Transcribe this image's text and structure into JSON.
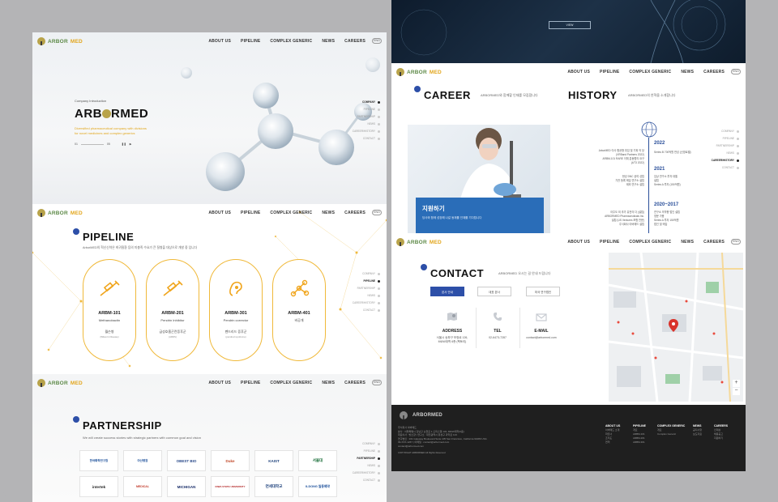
{
  "brand": {
    "part1": "ARBOR",
    "part2": "MED"
  },
  "nav": {
    "items": [
      "ABOUT US",
      "PIPELINE",
      "COMPLEX GENERIC",
      "NEWS",
      "CAREERS"
    ],
    "lang": "ENG"
  },
  "sidenav": {
    "items": [
      "COMPANY",
      "PIPELINE",
      "PARTNERSHIP",
      "NEWS",
      "CAREER/HISTORY",
      "CONTACT"
    ]
  },
  "hero": {
    "eyebrow": "Company Introduction",
    "title_a": "ARB",
    "title_b": "RMED",
    "desc1": "Diversified pharmaceutical company with divisions",
    "desc2": "for novel medicines and complex generics",
    "page_start": "01",
    "page_end": "05"
  },
  "pipeline": {
    "title": "PIPELINE",
    "subtitle": "ArborMED의 혁신신약은 희귀질환 등의 미충족 수요가 큰 질병을 대상으로 개발 중 입니다",
    "items": [
      {
        "code": "ARBM-101",
        "name": "Methanobactin",
        "ko": "월슨병",
        "en": "(Wilson's Disease)"
      },
      {
        "code": "ARBM-201",
        "name": "Pendrin Inhibitor",
        "ko": "급성호흡곤란증후군",
        "en": "(ARDS)"
      },
      {
        "code": "ARBM-301",
        "name": "Pendrin corrector",
        "ko": "펜드리드 증후군",
        "en": "(pendred syndrome)"
      },
      {
        "code": "ARBM-401",
        "name": "",
        "ko": "비공개",
        "en": ""
      }
    ]
  },
  "partnership": {
    "title": "PARTNERSHIP",
    "subtitle": "We will create success stories with strategic partners with common goal and vision",
    "row1": [
      "한국화학연구원",
      "아산병원",
      "OBEST BIO",
      "Duke",
      "KAIST",
      "서울대"
    ],
    "row2": [
      "intertek",
      "MEDICAL",
      "MICHIGAN",
      "IOWA STATE UNIVERSITY",
      "연세대학교",
      "ILDONG 일동제약"
    ]
  },
  "banner": {
    "button": "VIEW"
  },
  "career": {
    "title": "CAREER",
    "subtitle": "ARBORMED와 함께할 인재를 모집합니다",
    "card_title": "지원하기",
    "card_text": "당사와 함께 성장해 나갈 동재를 인재를 기다립니다"
  },
  "history": {
    "title": "HISTORY",
    "subtitle": "ARBORMED의 연혁을 소개합니다",
    "years": [
      "2022",
      "2021",
      "2020~2017"
    ],
    "y2022": [
      "ArborMED 이사 함공형 취임 및 기획 의 당",
      "(VRBand Partners 2022)",
      "ARBM-101 RARE 이체 분동협의 요구",
      "(4/73 2022)"
    ],
    "y2022r": [
      "Series B 700억원 천성 (신영로벨)"
    ],
    "y2021": [
      "현성 DNC 공여 성립",
      "기관 등록 매입 연구소 설립",
      "제외 연구소 설립",
      "임상 연구소 투자 대통",
      "설립",
      "Series A 투자 (150억원)"
    ],
    "y2020": [
      "아주도 외 추가 유전의 다 (설립)",
      "ARBORMED Pharmaceuticals Inc.",
      "설립 (US Ventures 포함 전문)",
      "주식회사 아버메드 설립"
    ],
    "y2020r": [
      "연구소 의약용 법인 설립",
      "영문 가용",
      "Series A 투자 150억원",
      "법인 및 매입"
    ]
  },
  "contact": {
    "title": "CONTACT",
    "subtitle": "ARBORMED 오시는 길 안내 드립니다",
    "buttons": [
      "본사 안내",
      "대표 본사",
      "미국 연구법인"
    ],
    "info": [
      {
        "label": "ADDRESS",
        "value": "서울시 송파구 보정로 126,",
        "value2": "M6/W대학 6층 (팩토리)"
      },
      {
        "label": "TEL",
        "value": "02-6473-7287",
        "value2": ""
      },
      {
        "label": "E-MAIL",
        "value": "contact@arbormed.com",
        "value2": ""
      }
    ]
  },
  "footer": {
    "brand": "ARBORMED",
    "lines": [
      "주식회사 아버메드",
      "본사 : 서울특별시 강남구 논현로 1 오피스텔 130, M6/W대학(6층)",
      "대표이사 : 방소향 | 연구소 : 대전광역시 유성구 과학로 123",
      "연구법인 : 101 Gateway Boulevard Suite 105 San Francisco, California 94080 USA",
      "09-XXX-1267 | 이메일 : contact@arbormed.com",
      "contact@arbormed.com"
    ],
    "copyright": "COPYRIGHT ARBORMED All Rights Reserved",
    "cols": [
      {
        "h": "ABOUT US",
        "items": [
          "아버메드 소개",
          "파트너",
          "조직도",
          "연혁"
        ]
      },
      {
        "h": "PIPELINE",
        "items": [
          "개요",
          "ARBM-101",
          "ARBM-201",
          "ARBM-301"
        ]
      },
      {
        "h": "COMPLEX GENERIC",
        "items": [
          "개요",
          "Complex Generic"
        ]
      },
      {
        "h": "NEWS",
        "items": [
          "공지사항",
          "보도자료"
        ]
      },
      {
        "h": "CAREERS",
        "items": [
          "인재상",
          "채용공고",
          "지원하기"
        ]
      }
    ]
  },
  "colors": {
    "accent": "#f0b93a",
    "blue": "#2d4fa8",
    "career_card": "#2a6db8",
    "dark": "#1f1f1f"
  }
}
